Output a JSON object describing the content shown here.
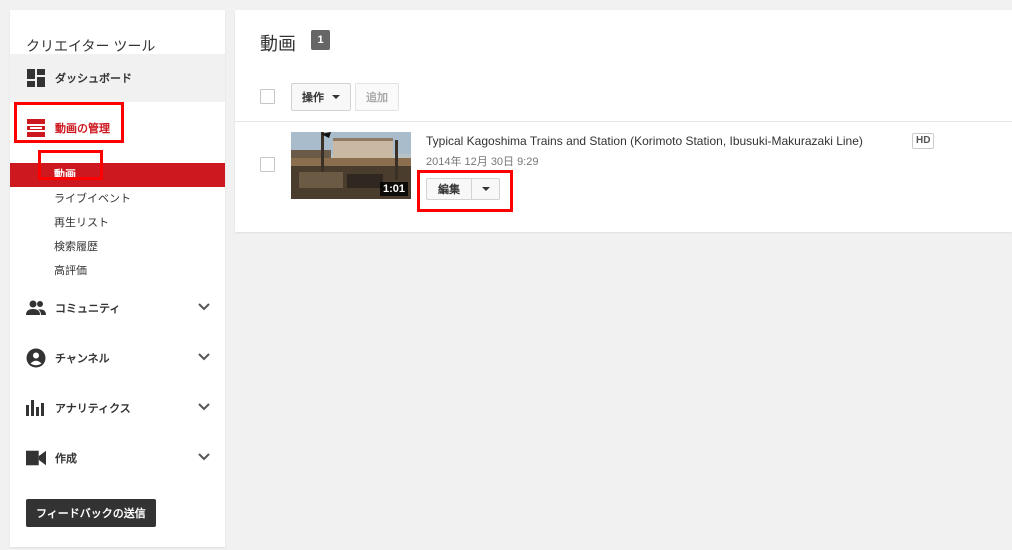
{
  "sidebar": {
    "title": "クリエイター ツール",
    "items": [
      {
        "label": "ダッシュボード",
        "icon": "dashboard-icon"
      },
      {
        "label": "動画の管理",
        "icon": "video-manager-icon"
      },
      {
        "label": "コミュニティ",
        "icon": "community-icon"
      },
      {
        "label": "チャンネル",
        "icon": "channel-icon"
      },
      {
        "label": "アナリティクス",
        "icon": "analytics-icon"
      },
      {
        "label": "作成",
        "icon": "create-icon"
      }
    ],
    "sub_items": [
      {
        "label": "動画",
        "selected": true
      },
      {
        "label": "ライブイベント"
      },
      {
        "label": "再生リスト"
      },
      {
        "label": "検索履歴"
      },
      {
        "label": "高評価"
      }
    ],
    "feedback_label": "フィードバックの送信"
  },
  "main": {
    "title": "動画",
    "count": "1",
    "actions_label": "操作",
    "add_label": "追加",
    "video": {
      "title": "Typical Kagoshima Trains and Station (Korimoto Station, Ibusuki-Makurazaki Line)",
      "hd": "HD",
      "date": "2014年 12月 30日  9:29",
      "duration": "1:01",
      "edit_label": "編集"
    }
  },
  "colors": {
    "accent": "#cc181e",
    "highlight": "#ff0000",
    "background": "#f1f1f1"
  }
}
